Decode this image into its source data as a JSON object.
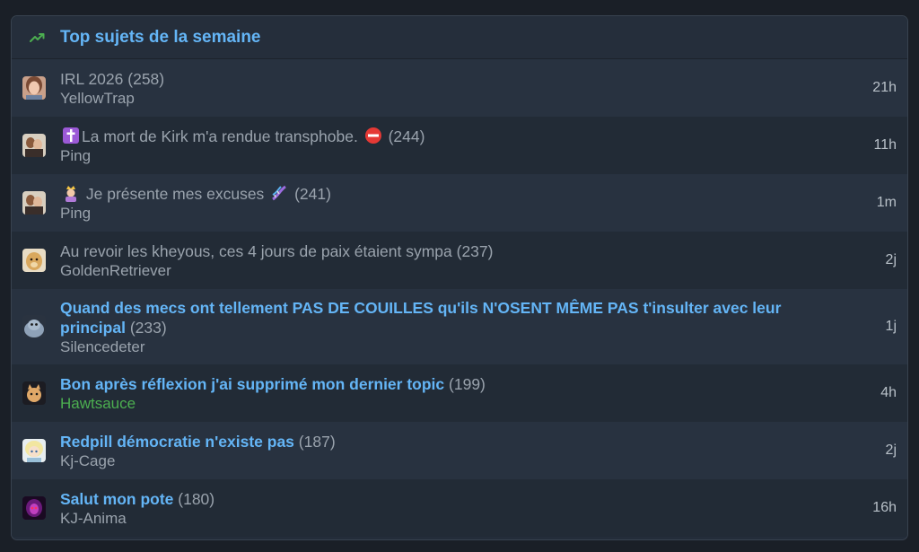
{
  "header": {
    "title": "Top sujets de la semaine",
    "icon": "trending-up-icon",
    "accent": "#64b5f6",
    "icon_color": "#4caf50"
  },
  "topics": [
    {
      "title": "IRL 2026",
      "count": "(258)",
      "author": "YellowTrap",
      "time": "21h",
      "read": true,
      "avatar": "portrait"
    },
    {
      "title": "La mort de Kirk m'a rendue transphobe.",
      "count": "(244)",
      "author": "Ping",
      "time": "11h",
      "read": true,
      "avatar": "photo",
      "prefix_emoji": "latin-cross-icon",
      "suffix_emoji": "no-entry-icon"
    },
    {
      "title": "Je présente mes excuses",
      "count": "(241)",
      "author": "Ping",
      "time": "1m",
      "read": true,
      "avatar": "photo",
      "prefix_emoji": "princess-icon",
      "suffix_emoji": "dna-icon"
    },
    {
      "title": "Au revoir les kheyous, ces 4 jours de paix étaient sympa",
      "count": "(237)",
      "author": "GoldenRetriever",
      "time": "2j",
      "read": true,
      "avatar": "dog"
    },
    {
      "title": "Quand des mecs ont tellement PAS DE COUILLES qu'ils N'OSENT MÊME PAS t'insulter avec leur principal",
      "count": "(233)",
      "author": "Silencedeter",
      "time": "1j",
      "read": false,
      "avatar": "seal"
    },
    {
      "title": "Bon après réflexion j'ai supprimé mon dernier topic",
      "count": "(199)",
      "author": "Hawtsauce",
      "time": "4h",
      "read": false,
      "avatar": "cat",
      "author_color": "green"
    },
    {
      "title": "Redpill démocratie n'existe pas",
      "count": "(187)",
      "author": "Kj-Cage",
      "time": "2j",
      "read": false,
      "avatar": "anime"
    },
    {
      "title": "Salut mon pote",
      "count": "(180)",
      "author": "KJ-Anima",
      "time": "16h",
      "read": false,
      "avatar": "dark"
    }
  ]
}
